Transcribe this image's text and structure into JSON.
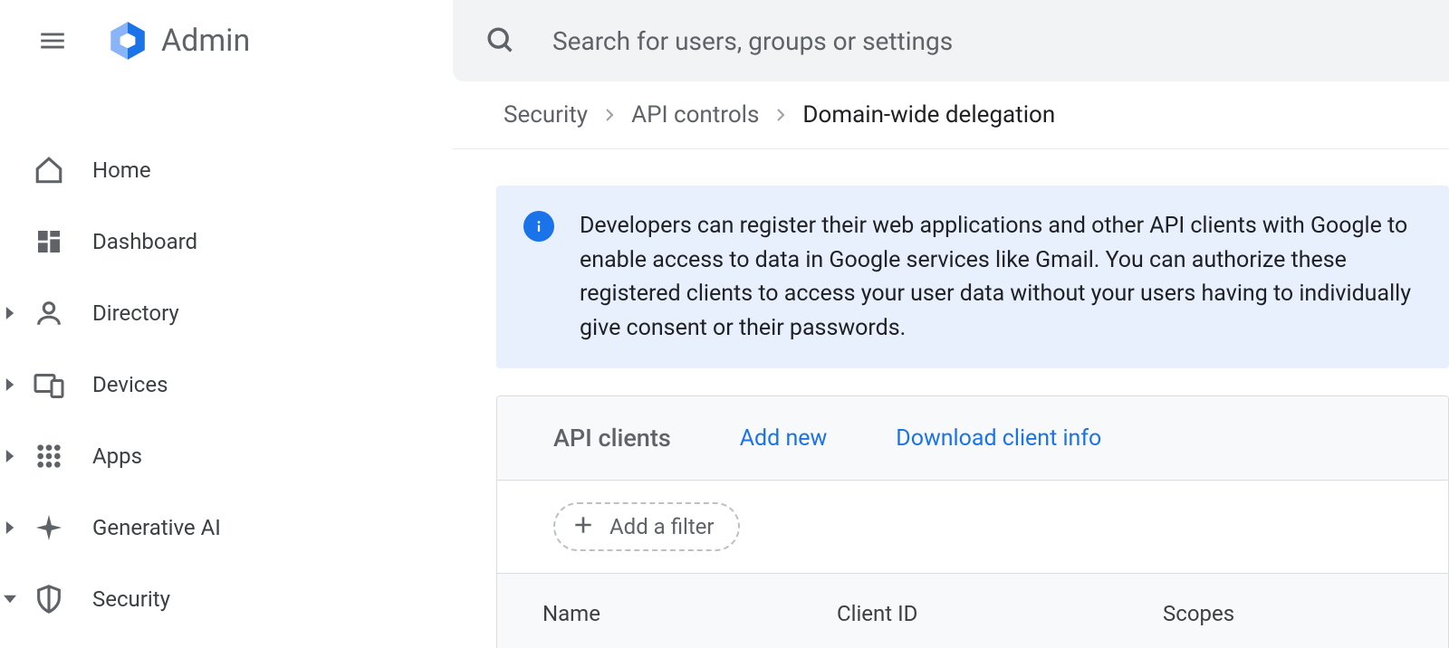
{
  "app_title": "Admin",
  "search": {
    "placeholder": "Search for users, groups or settings"
  },
  "sidebar": {
    "items": [
      {
        "label": "Home",
        "icon": "home",
        "expandable": false
      },
      {
        "label": "Dashboard",
        "icon": "dashboard",
        "expandable": false
      },
      {
        "label": "Directory",
        "icon": "person",
        "expandable": true
      },
      {
        "label": "Devices",
        "icon": "devices",
        "expandable": true
      },
      {
        "label": "Apps",
        "icon": "apps",
        "expandable": true
      },
      {
        "label": "Generative AI",
        "icon": "sparkle",
        "expandable": true
      },
      {
        "label": "Security",
        "icon": "shield",
        "expandable": true,
        "expanded": true
      }
    ]
  },
  "breadcrumb": [
    {
      "label": "Security",
      "active": false
    },
    {
      "label": "API controls",
      "active": false
    },
    {
      "label": "Domain-wide delegation",
      "active": true
    }
  ],
  "info_banner": "Developers can register their web applications and other API clients with Google to enable access to data in Google services like Gmail. You can authorize these registered clients to access your user data without your users having to individually give consent or their passwords.",
  "api_clients": {
    "title": "API clients",
    "actions": {
      "add_new": "Add new",
      "download": "Download client info"
    },
    "filter": {
      "label": "Add a filter"
    },
    "columns": {
      "name": "Name",
      "client_id": "Client ID",
      "scopes": "Scopes"
    }
  }
}
